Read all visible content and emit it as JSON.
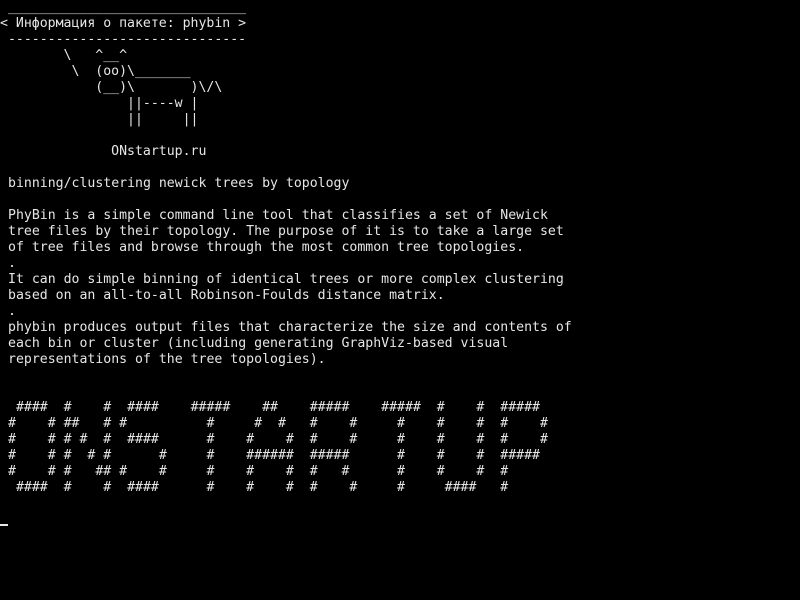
{
  "terminal": {
    "bubble_border_top": " ______________________________",
    "bubble_title": "< Информация о пакете: phybin >",
    "bubble_border_bottom": " ------------------------------",
    "cow_art": "        \\   ^__^\n         \\  (oo)\\_______\n            (__)\\       )\\/\\\n                ||----w |\n                ||     ||",
    "site_name": "              ONstartup.ru",
    "short_description": "binning/clustering newick trees by topology",
    "long_description": "PhyBin is a simple command line tool that classifies a set of Newick\ntree files by their topology. The purpose of it is to take a large set\nof tree files and browse through the most common tree topologies.\n.\nIt can do simple binning of identical trees or more complex clustering\nbased on an all-to-all Robinson-Foulds distance matrix.\n.\nphybin produces output files that characterize the size and contents of\neach bin or cluster (including generating GraphViz-based visual\nrepresentations of the tree topologies).",
    "banner": " ####  #    #  ####    #####    ##    #####    #####  #    #  #####\n#    # ##   # #          #     #  #   #    #     #    #    #  #    #\n#    # # #  #  ####      #    #    #  #    #     #    #    #  #    #\n#    # #  # #      #     #    ######  #####      #    #    #  #####\n#    # #   ## #    #     #    #    #  #   #      #    #    #  #\n ####  #    #  ####      #    #    #  #    #     #     ####   #",
    "colors": {
      "background": "#000000",
      "text": "#e6e6e6"
    }
  }
}
